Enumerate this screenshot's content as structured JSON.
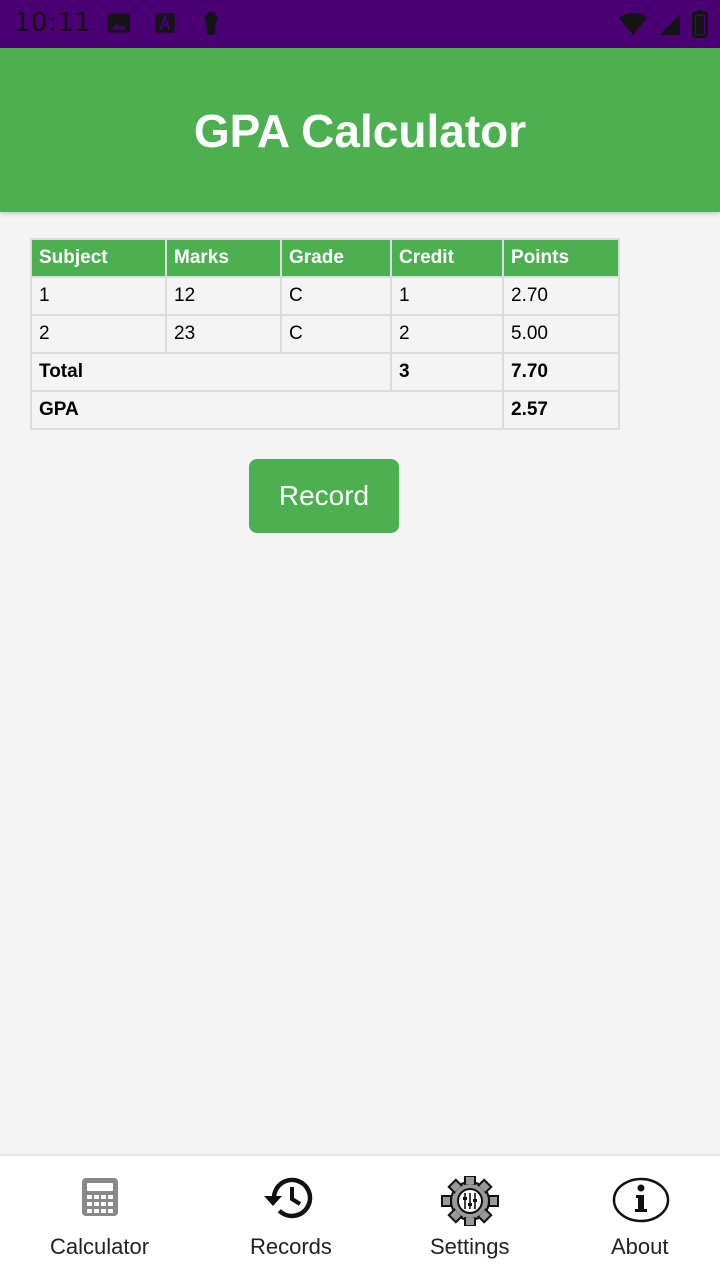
{
  "status_bar": {
    "time": "10:11",
    "background": "#4a0072"
  },
  "app_bar": {
    "title": "GPA Calculator",
    "color": "#4caf50"
  },
  "table": {
    "headers": [
      "Subject",
      "Marks",
      "Grade",
      "Credit",
      "Points"
    ],
    "rows": [
      [
        "1",
        "12",
        "C",
        "1",
        "2.70"
      ],
      [
        "2",
        "23",
        "C",
        "2",
        "5.00"
      ]
    ],
    "total": {
      "label": "Total",
      "credit": "3",
      "points": "7.70"
    },
    "gpa": {
      "label": "GPA",
      "value": "2.57"
    }
  },
  "record_button": {
    "label": "Record"
  },
  "bottom_nav": {
    "items": [
      {
        "label": "Calculator",
        "icon": "calculator-icon"
      },
      {
        "label": "Records",
        "icon": "history-icon"
      },
      {
        "label": "Settings",
        "icon": "settings-gear-icon"
      },
      {
        "label": "About",
        "icon": "info-icon"
      }
    ]
  }
}
